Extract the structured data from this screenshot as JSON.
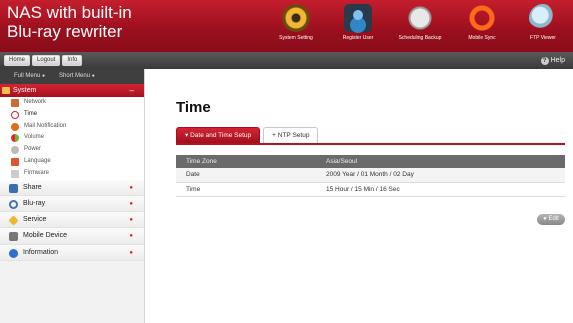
{
  "header": {
    "brand_line1": "NAS with built-in",
    "brand_line2": "Blu-ray rewriter",
    "nav": [
      {
        "label": "System Setting",
        "icon": "gear-icon"
      },
      {
        "label": "Register User",
        "icon": "user-icon"
      },
      {
        "label": "Scheduling Backup",
        "icon": "schedule-icon"
      },
      {
        "label": "Mobile Sync",
        "icon": "sync-icon"
      },
      {
        "label": "FTP Viewer",
        "icon": "ftp-icon"
      }
    ]
  },
  "toolbar": {
    "home": "Home",
    "logout": "Logout",
    "info": "Info",
    "help": "Help"
  },
  "sidebar": {
    "full_menu": "Full Menu",
    "short_menu": "Short Menu",
    "system_label": "System",
    "system_items": [
      {
        "label": "Network"
      },
      {
        "label": "Time"
      },
      {
        "label": "Mail Notification"
      },
      {
        "label": "Volume"
      },
      {
        "label": "Power"
      },
      {
        "label": "Language"
      },
      {
        "label": "Firmware"
      }
    ],
    "sections": [
      {
        "label": "Share"
      },
      {
        "label": "Blu-ray"
      },
      {
        "label": "Service"
      },
      {
        "label": "Mobile Device"
      },
      {
        "label": "Information"
      }
    ]
  },
  "main": {
    "title": "Time",
    "tabs": [
      {
        "label": "Date and Time Setup"
      },
      {
        "label": "NTP Setup"
      }
    ],
    "table": {
      "header": [
        "Time Zone",
        "Asia/Seoul"
      ],
      "rows": [
        [
          "Date",
          "2009 Year / 01 Month / 02 Day"
        ],
        [
          "Time",
          "15 Hour / 15 Min / 16 Sec"
        ]
      ]
    },
    "edit_label": "Edit"
  },
  "colors": {
    "brand_red": "#b3121f",
    "toolbar_dark": "#4a4a4a"
  }
}
